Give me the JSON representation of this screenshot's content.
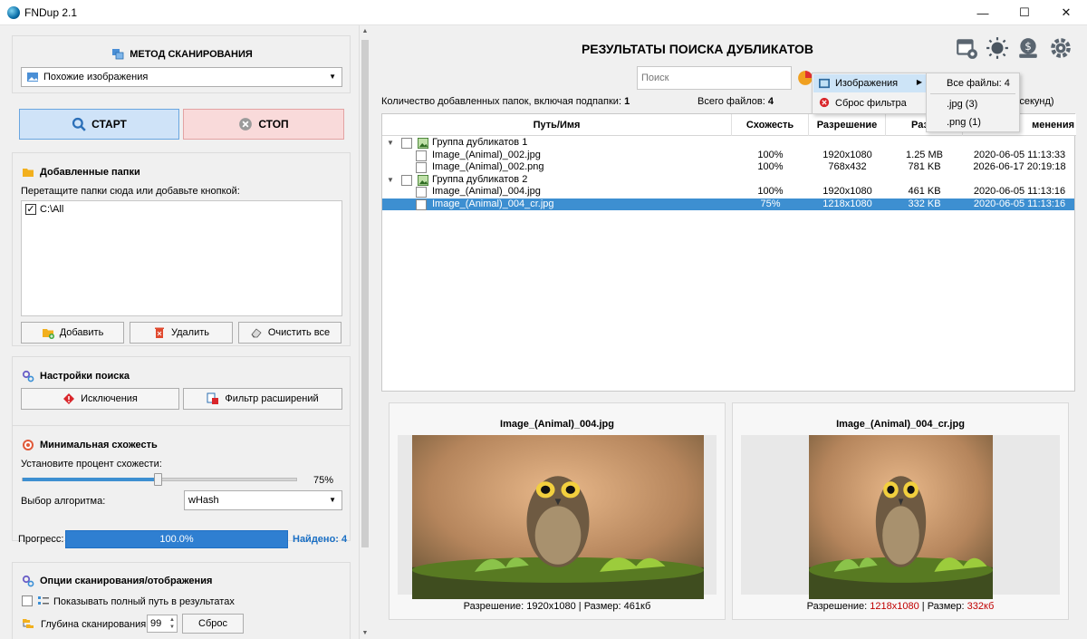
{
  "window": {
    "title": "FNDup 2.1"
  },
  "left": {
    "method": {
      "title": "МЕТОД СКАНИРОВАНИЯ",
      "selected": "Похожие изображения"
    },
    "start_label": "СТАРТ",
    "stop_label": "СТОП",
    "folders": {
      "title": "Добавленные папки",
      "hint": "Перетащите папки сюда или добавьте кнопкой:",
      "items": [
        {
          "path": "C:\\All",
          "checked": true
        }
      ],
      "add_label": "Добавить",
      "delete_label": "Удалить",
      "clear_label": "Очистить все"
    },
    "search_settings": {
      "title": "Настройки поиска",
      "exclusions_label": "Исключения",
      "ext_filter_label": "Фильтр расширений"
    },
    "similarity": {
      "title": "Минимальная схожесть",
      "label": "Установите процент схожести:",
      "value_text": "75%",
      "value": 75,
      "algo_label": "Выбор алгоритма:",
      "algo": "wHash"
    },
    "progress": {
      "label": "Прогресс:",
      "value_text": "100.0%",
      "value": 100,
      "found": "Найдено: 4"
    },
    "options": {
      "title": "Опции сканирования/отображения",
      "fullpath_label": "Показывать полный путь в результатах",
      "depth_label": "Глубина сканирования:",
      "depth": "99",
      "reset_label": "Сброс"
    }
  },
  "right": {
    "title": "РЕЗУЛЬТАТЫ ПОИСКА ДУБЛИКАТОВ",
    "search_placeholder": "Поиск",
    "folders_count_label": "Количество добавленных папок, включая подпапки:",
    "folders_count": "1",
    "total_files_label": "Всего файлов:",
    "total_files": "4",
    "time_text": "ы и 4 секунд)",
    "columns": {
      "path": "Путь/Имя",
      "sim": "Схожесть",
      "res": "Разрешение",
      "size": "Разм",
      "date": "менения"
    },
    "groups": [
      {
        "name": "Группа дубликатов 1",
        "files": [
          {
            "name": "Image_(Animal)_002.jpg",
            "sim": "100%",
            "res": "1920x1080",
            "size": "1.25 MB",
            "date": "2020-06-05 11:13:33"
          },
          {
            "name": "Image_(Animal)_002.png",
            "sim": "100%",
            "res": "768x432",
            "size": "781 KB",
            "date": "2026-06-17 20:19:18"
          }
        ]
      },
      {
        "name": "Группа дубликатов 2",
        "files": [
          {
            "name": "Image_(Animal)_004.jpg",
            "sim": "100%",
            "res": "1920x1080",
            "size": "461 KB",
            "date": "2020-06-05 11:13:16"
          },
          {
            "name": "Image_(Animal)_004_cr.jpg",
            "sim": "75%",
            "res": "1218x1080",
            "size": "332 KB",
            "date": "2020-06-05 11:13:16"
          }
        ]
      }
    ],
    "menu": {
      "images": "Изображения",
      "reset_filter": "Сброс фильтра",
      "all_files": "Все файлы: 4",
      "jpg": ".jpg (3)",
      "png": ".png (1)"
    },
    "preview_left": {
      "title": "Image_(Animal)_004.jpg",
      "res_label": "Разрешение: ",
      "res": "1920x1080",
      "sep": " | Размер: ",
      "size": "461кб"
    },
    "preview_right": {
      "title": "Image_(Animal)_004_cr.jpg",
      "res_label": "Разрешение: ",
      "res": "1218x1080",
      "sep": " | Размер: ",
      "size": "332кб"
    }
  },
  "colors": {
    "accent": "#3d8fd1",
    "progress": "#2f7fd1",
    "found": "#1a6fc4",
    "highlight": "#c00000"
  }
}
